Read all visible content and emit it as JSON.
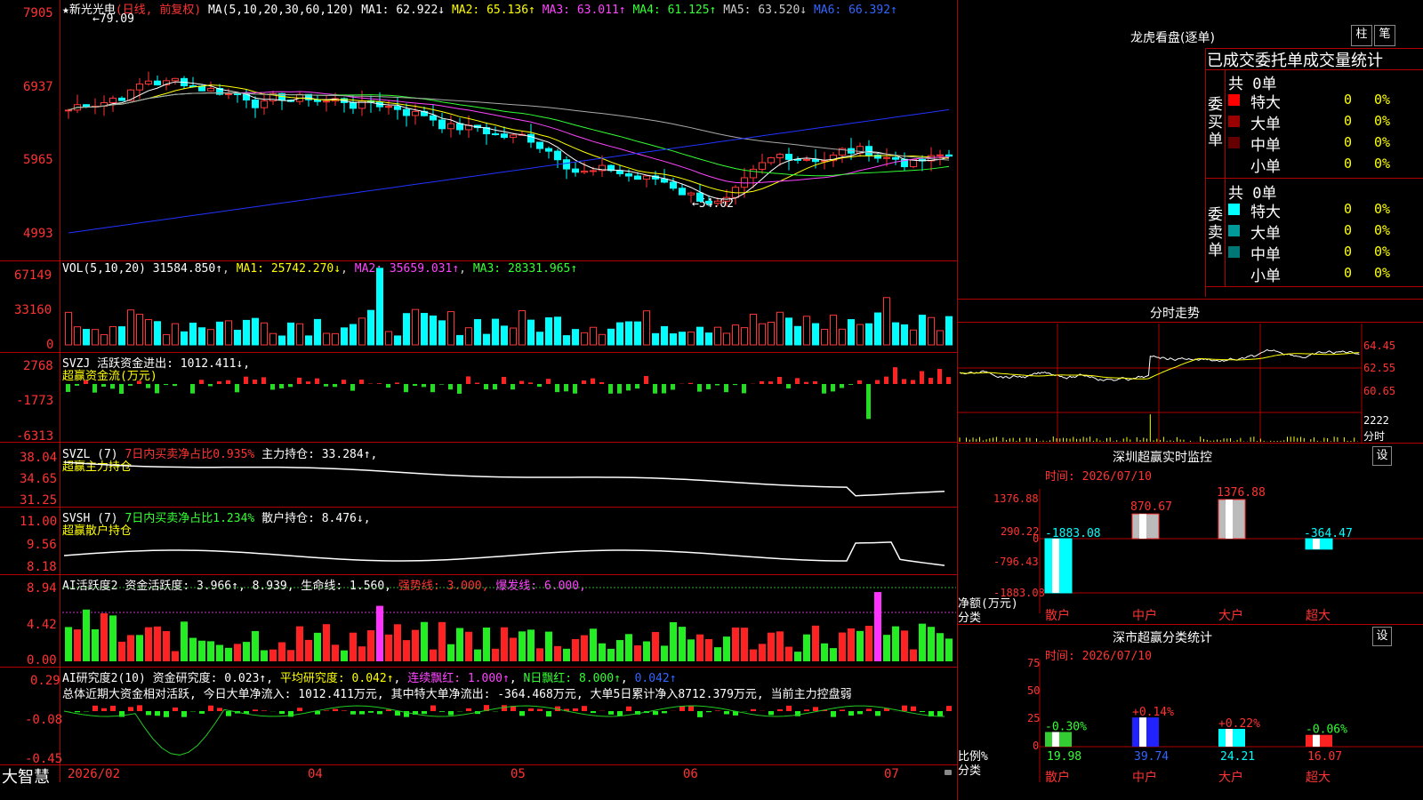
{
  "stock": {
    "star": "★",
    "name": "新光光电",
    "period": "(日线, 前复权)"
  },
  "ma_header": {
    "title": "MA(5,10,20,30,60,120)",
    "items": [
      {
        "label": "MA1: 62.922↓",
        "color": "#ffffff"
      },
      {
        "label": "MA2: 65.136↑",
        "color": "#ffff00"
      },
      {
        "label": "MA3: 63.011↑",
        "color": "#ff44ff"
      },
      {
        "label": "MA4: 61.125↑",
        "color": "#33ff33"
      },
      {
        "label": "MA5: 63.520↓",
        "color": "#cccccc"
      },
      {
        "label": "MA6: 66.392↑",
        "color": "#3366ff"
      }
    ]
  },
  "price_axis": [
    "7905",
    "6937",
    "5965",
    "4993"
  ],
  "price_marks": {
    "high": "79.09",
    "low": "54.02"
  },
  "vol_header": {
    "title": "VOL(5,10,20)",
    "value": "31584.850↑",
    "ma1": "MA1: 25742.270↓",
    "ma2": "MA2: 35659.031↑",
    "ma3": "MA3: 28331.965↑"
  },
  "vol_axis": [
    "67149",
    "33160",
    "0"
  ],
  "svzj": {
    "title": "SVZJ",
    "text": "活跃资金进出: 1012.411↓,",
    "sub": "超赢资金流(万元)",
    "axis": [
      "2768",
      "-1773",
      "-6313"
    ]
  },
  "svzl": {
    "title": "SVZL (7)",
    "red": "7日内买卖净占比0.935%",
    "text": "主力持仓: 33.284↑,",
    "sub": "超赢主力持仓",
    "axis": [
      "38.04",
      "34.65",
      "31.25"
    ]
  },
  "svsh": {
    "title": "SVSH (7)",
    "green": "7日内买卖净占比1.234%",
    "text": "散户持仓: 8.476↓,",
    "sub": "超赢散户持仓",
    "axis": [
      "11.00",
      "9.56",
      "8.18"
    ]
  },
  "ai1": {
    "title": "AI活跃度2",
    "a": "资金活跃度: 3.966↑",
    "b": "8.939,",
    "c": "生命线: 1.560,",
    "d": "强势线: 3.000,",
    "e": "爆发线: 6.000,",
    "axis": [
      "8.94",
      "4.42",
      "0.00"
    ]
  },
  "ai2": {
    "title": "AI研究度2(10)",
    "a": "资金研究度: 0.023↑",
    "b": "平均研究度: 0.042↑",
    "c": "连续飘红: 1.000↑",
    "d": "N日飘红: 8.000↑",
    "e": "0.042↑",
    "summary": "总体近期大资金相对活跃, 今日大单净流入: 1012.411万元, 其中特大单净流出: -364.468万元, 大单5日累计净入8712.379万元, 当前主力控盘弱",
    "axis": [
      "0.29",
      "-0.08",
      "-0.45"
    ]
  },
  "date_axis": [
    "2026/02",
    "04",
    "05",
    "06",
    "07"
  ],
  "brand": "大智慧",
  "right": {
    "title": "龙虎看盘(逐单)",
    "btn1": "柱",
    "btn2": "笔",
    "tabs": "已成交委托单成交量统计",
    "buy": {
      "label": "委买单",
      "total": "共 0单",
      "rows": [
        {
          "name": "特大",
          "n": "0",
          "p": "0%",
          "color": "#ff0000"
        },
        {
          "name": "大单",
          "n": "0",
          "p": "0%",
          "color": "#990000"
        },
        {
          "name": "中单",
          "n": "0",
          "p": "0%",
          "color": "#660000"
        },
        {
          "name": "小单",
          "n": "0",
          "p": "0%",
          "color": ""
        }
      ]
    },
    "sell": {
      "label": "委卖单",
      "total": "共 0单",
      "rows": [
        {
          "name": "特大",
          "n": "0",
          "p": "0%",
          "color": "#00ffff"
        },
        {
          "name": "大单",
          "n": "0",
          "p": "0%",
          "color": "#009999"
        },
        {
          "name": "中单",
          "n": "0",
          "p": "0%",
          "color": "#007777"
        },
        {
          "name": "小单",
          "n": "0",
          "p": "0%",
          "color": ""
        }
      ]
    }
  },
  "intraday": {
    "title": "分时走势",
    "axis": [
      "64.45",
      "62.55",
      "60.65"
    ],
    "vol": "2222",
    "vol_unit": "分时"
  },
  "sz_monitor": {
    "title": "深圳超赢实时监控",
    "btn": "设",
    "time": "时间: 2026/07/10",
    "axis": [
      "1376.88",
      "290.22",
      "0",
      "-796.43",
      "-1883.08"
    ],
    "ylabel": "净额(万元)",
    "xlabel": "分类",
    "bars": [
      {
        "cat": "散户",
        "value": -1883.08,
        "label": "-1883.08"
      },
      {
        "cat": "中户",
        "value": 870.67,
        "label": "870.67"
      },
      {
        "cat": "大户",
        "value": 1376.88,
        "label": "1376.88"
      },
      {
        "cat": "超大",
        "value": -364.47,
        "label": "-364.47"
      }
    ]
  },
  "sz_class": {
    "title": "深市超赢分类统计",
    "btn": "设",
    "time": "时间: 2026/07/10",
    "axis": [
      "75",
      "50",
      "25",
      "0"
    ],
    "ylabel": "比例%",
    "xlabel": "分类",
    "bars": [
      {
        "cat": "散户",
        "value": 19.98,
        "label": "19.98",
        "chg": "-0.30%",
        "color": "#33cc33"
      },
      {
        "cat": "中户",
        "value": 39.74,
        "label": "39.74",
        "chg": "+0.14%",
        "color": "#2222ff"
      },
      {
        "cat": "大户",
        "value": 24.21,
        "label": "24.21",
        "chg": "+0.22%",
        "color": "#00ffff"
      },
      {
        "cat": "超大",
        "value": 16.07,
        "label": "16.07",
        "chg": "-0.06%",
        "color": "#ff2222"
      }
    ]
  },
  "chart_data": [
    {
      "type": "bar",
      "title": "深圳超赢实时监控",
      "categories": [
        "散户",
        "中户",
        "大户",
        "超大"
      ],
      "values": [
        -1883.08,
        870.67,
        1376.88,
        -364.47
      ],
      "ylabel": "净额(万元)",
      "xlabel": "分类",
      "ylim": [
        -1883.08,
        1376.88
      ]
    },
    {
      "type": "bar",
      "title": "深市超赢分类统计",
      "categories": [
        "散户",
        "中户",
        "大户",
        "超大"
      ],
      "values": [
        19.98,
        39.74,
        24.21,
        16.07
      ],
      "ylabel": "比例%",
      "xlabel": "分类",
      "ylim": [
        0,
        75
      ]
    }
  ]
}
